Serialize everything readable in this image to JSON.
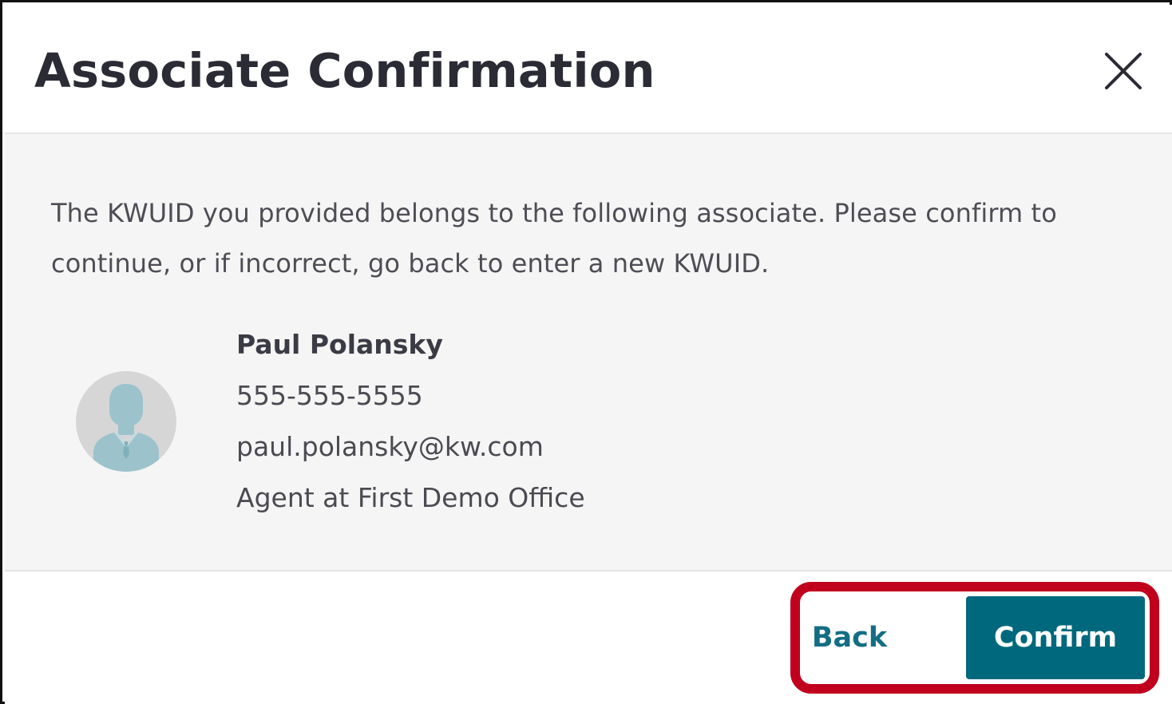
{
  "dialog": {
    "title": "Associate Confirmation",
    "close_icon": "close-icon",
    "message": "The KWUID you provided belongs to the following associate. Please confirm to continue, or if incorrect, go back to enter a new KWUID."
  },
  "associate": {
    "avatar_icon": "person-avatar-icon",
    "name": "Paul Polansky",
    "phone": "555-555-5555",
    "email": "paul.polansky@kw.com",
    "role": "Agent at First Demo Office"
  },
  "actions": {
    "back_label": "Back",
    "confirm_label": "Confirm"
  },
  "colors": {
    "primary": "#00687c",
    "link": "#136d84",
    "highlight": "#c0001d",
    "body_background": "#f5f5f5",
    "avatar_figure": "#9cc3cc"
  }
}
